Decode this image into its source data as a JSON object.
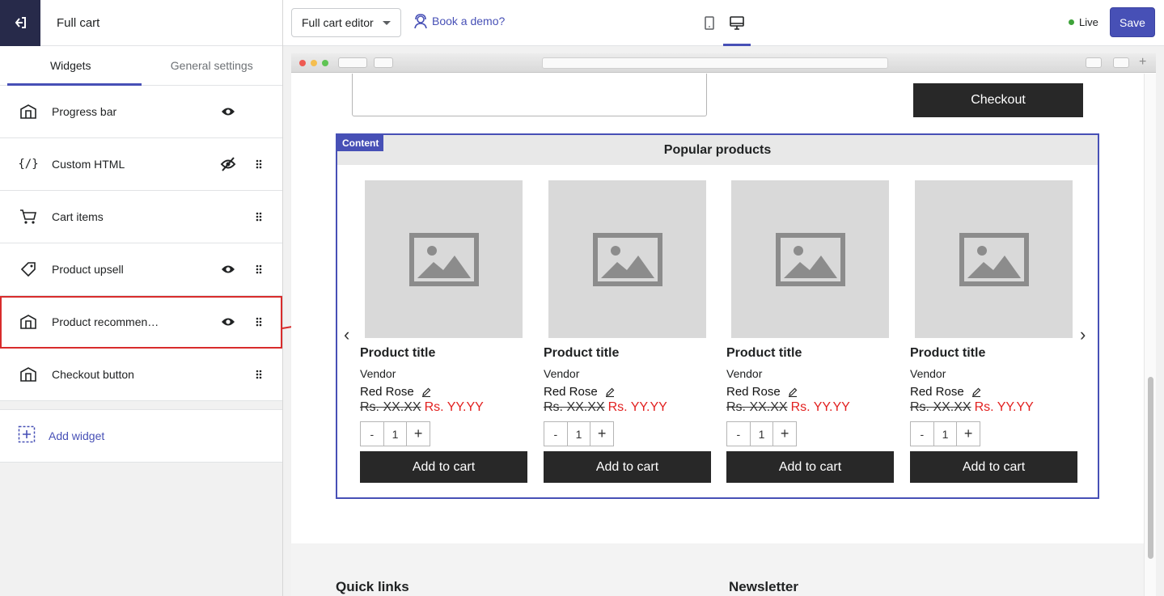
{
  "sidebar": {
    "header_title": "Full cart",
    "tabs": [
      {
        "label": "Widgets",
        "active": true
      },
      {
        "label": "General settings",
        "active": false
      }
    ],
    "widgets": [
      {
        "label": "Progress bar",
        "icon": "layout-icon",
        "visible": true,
        "draggable": false
      },
      {
        "label": "Custom HTML",
        "icon": "code-icon",
        "visible": false,
        "draggable": true
      },
      {
        "label": "Cart items",
        "icon": "cart-icon",
        "visible": null,
        "draggable": true
      },
      {
        "label": "Product upsell",
        "icon": "tag-icon",
        "visible": true,
        "draggable": true
      },
      {
        "label": "Product recommen…",
        "icon": "layout-icon",
        "visible": true,
        "draggable": true,
        "highlighted": true
      },
      {
        "label": "Checkout button",
        "icon": "layout-icon",
        "visible": null,
        "draggable": true
      }
    ],
    "add_widget_label": "Add widget"
  },
  "topbar": {
    "editor_select_value": "Full cart editor",
    "demo_link": "Book a demo?",
    "status_label": "Live",
    "save_label": "Save",
    "active_device": "desktop"
  },
  "preview": {
    "checkout_label": "Checkout",
    "content_tag": "Content",
    "section_title": "Popular products",
    "products": [
      {
        "title": "Product title",
        "vendor": "Vendor",
        "variant": "Red Rose",
        "compare_price": "Rs. XX.XX",
        "price": "Rs. YY.YY",
        "qty": "1",
        "minus": "-",
        "plus": "+",
        "cta": "Add to cart"
      },
      {
        "title": "Product title",
        "vendor": "Vendor",
        "variant": "Red Rose",
        "compare_price": "Rs. XX.XX",
        "price": "Rs. YY.YY",
        "qty": "1",
        "minus": "-",
        "plus": "+",
        "cta": "Add to cart"
      },
      {
        "title": "Product title",
        "vendor": "Vendor",
        "variant": "Red Rose",
        "compare_price": "Rs. XX.XX",
        "price": "Rs. YY.YY",
        "qty": "1",
        "minus": "-",
        "plus": "+",
        "cta": "Add to cart"
      },
      {
        "title": "Product title",
        "vendor": "Vendor",
        "variant": "Red Rose",
        "compare_price": "Rs. XX.XX",
        "price": "Rs. YY.YY",
        "qty": "1",
        "minus": "-",
        "plus": "+",
        "cta": "Add to cart"
      }
    ],
    "prev_arrow": "‹",
    "next_arrow": "›",
    "footer": {
      "quick_links": "Quick links",
      "newsletter": "Newsletter"
    }
  },
  "colors": {
    "accent": "#4750b6",
    "highlight": "#d82c2c",
    "sale_price": "#e22120",
    "live": "#3fa33a",
    "button_dark": "#282828"
  }
}
